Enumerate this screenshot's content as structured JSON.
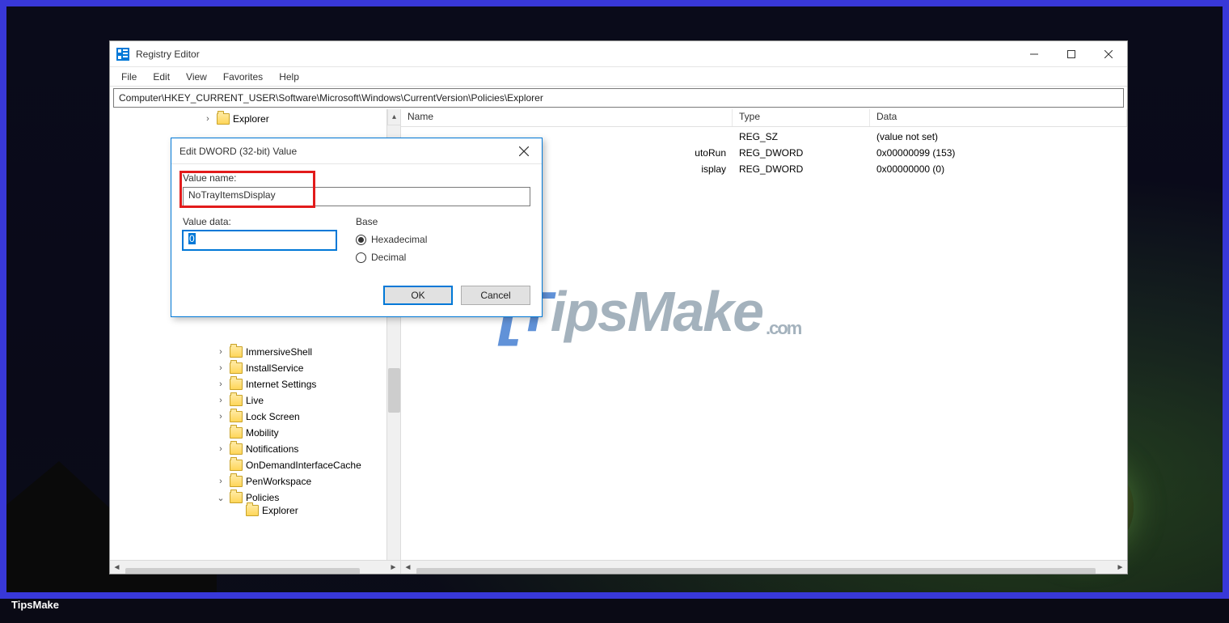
{
  "outer": {
    "caption": "TipsMake"
  },
  "window": {
    "title": "Registry Editor",
    "menu": {
      "file": "File",
      "edit": "Edit",
      "view": "View",
      "favorites": "Favorites",
      "help": "Help"
    },
    "address": "Computer\\HKEY_CURRENT_USER\\Software\\Microsoft\\Windows\\CurrentVersion\\Policies\\Explorer"
  },
  "tree": {
    "selected": "Explorer",
    "nodes": [
      {
        "label": "Explorer",
        "expandable": true,
        "indent": 70,
        "top": true
      },
      {
        "label": "ImmersiveShell",
        "expandable": true,
        "indent": 86
      },
      {
        "label": "InstallService",
        "expandable": true,
        "indent": 86
      },
      {
        "label": "Internet Settings",
        "expandable": true,
        "indent": 86
      },
      {
        "label": "Live",
        "expandable": true,
        "indent": 86
      },
      {
        "label": "Lock Screen",
        "expandable": true,
        "indent": 86
      },
      {
        "label": "Mobility",
        "expandable": false,
        "indent": 86
      },
      {
        "label": "Notifications",
        "expandable": true,
        "indent": 86
      },
      {
        "label": "OnDemandInterfaceCache",
        "expandable": false,
        "indent": 86
      },
      {
        "label": "PenWorkspace",
        "expandable": true,
        "indent": 86
      },
      {
        "label": "Policies",
        "expandable": true,
        "expanded": true,
        "indent": 86
      },
      {
        "label": "Explorer",
        "expandable": false,
        "indent": 106,
        "cutoff": true
      }
    ]
  },
  "list": {
    "headers": {
      "name": "Name",
      "type": "Type",
      "data": "Data"
    },
    "rows": [
      {
        "name_suffix": "",
        "type": "REG_SZ",
        "data": "(value not set)"
      },
      {
        "name_suffix": "utoRun",
        "type": "REG_DWORD",
        "data": "0x00000099 (153)"
      },
      {
        "name_suffix": "isplay",
        "type": "REG_DWORD",
        "data": "0x00000000 (0)"
      }
    ]
  },
  "dialog": {
    "title": "Edit DWORD (32-bit) Value",
    "value_name_label": "Value name:",
    "value_name": "NoTrayItemsDisplay",
    "value_data_label": "Value data:",
    "value_data": "0",
    "base_label": "Base",
    "hex_label": "Hexadecimal",
    "dec_label": "Decimal",
    "ok": "OK",
    "cancel": "Cancel"
  },
  "watermark": {
    "t": "T",
    "ips": "ips",
    "make": "Make",
    "com": ".com"
  }
}
